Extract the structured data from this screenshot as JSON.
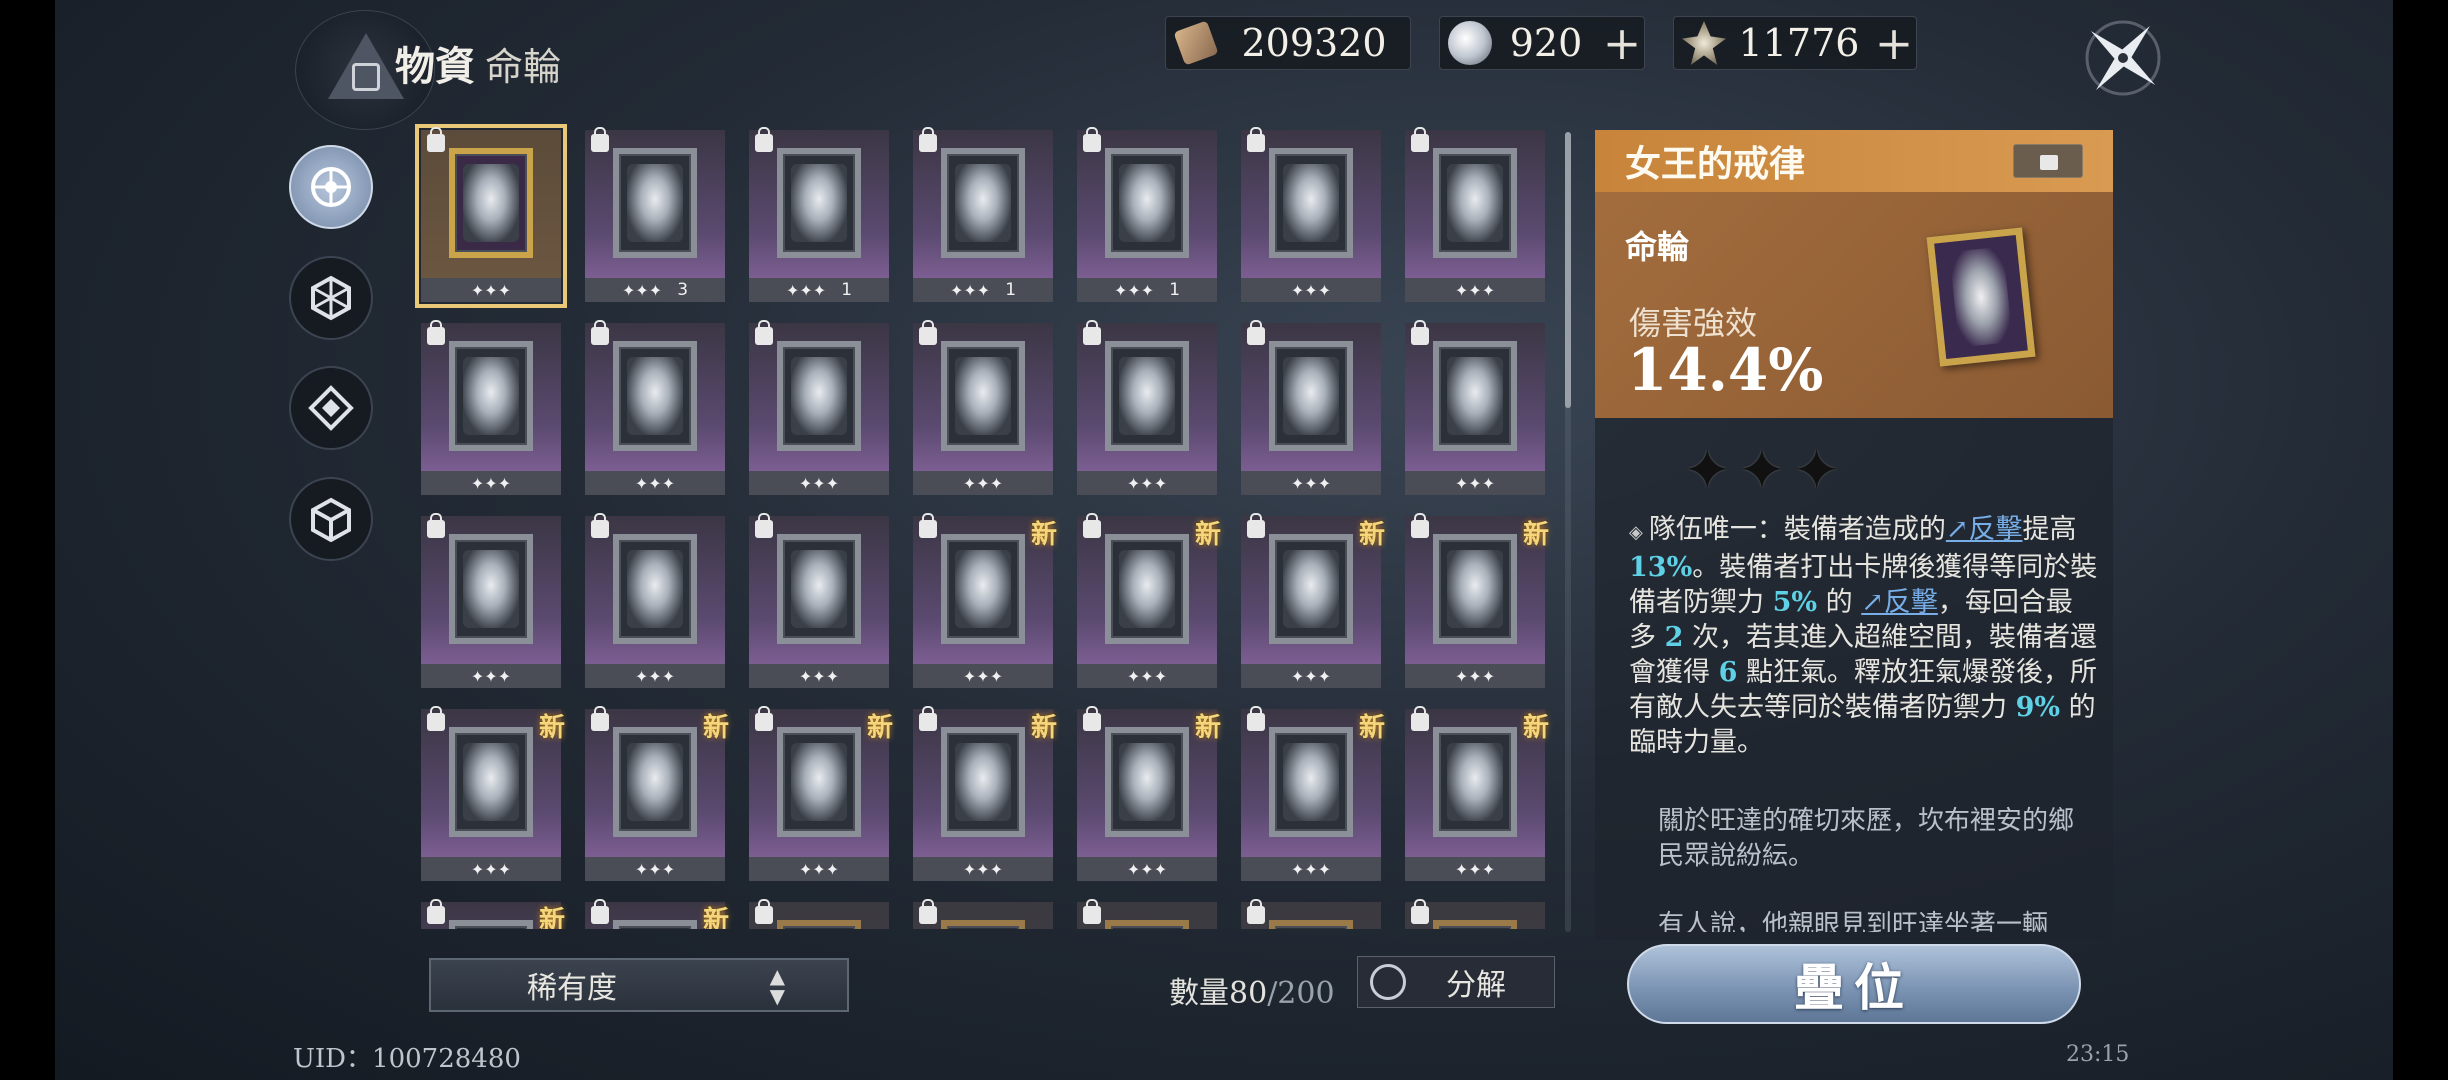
{
  "header": {
    "title": "物資",
    "subtitle": "命輪"
  },
  "currencies": [
    {
      "icon": "ticket-icon",
      "value": "209320",
      "has_plus": false
    },
    {
      "icon": "orb-icon",
      "value": "920",
      "has_plus": true
    },
    {
      "icon": "shard-icon",
      "value": "11776",
      "has_plus": true
    }
  ],
  "plus_label": "+",
  "nav": [
    {
      "name": "nav-destiny-wheel",
      "active": true
    },
    {
      "name": "nav-hexagon",
      "active": false
    },
    {
      "name": "nav-diamond",
      "active": false
    },
    {
      "name": "nav-cube",
      "active": false
    }
  ],
  "grid": {
    "new_label": "新",
    "rows": [
      [
        {
          "stars": "✦✦✦",
          "count": "",
          "new": false,
          "selected": true
        },
        {
          "stars": "✦✦✦",
          "count": "3",
          "new": false
        },
        {
          "stars": "✦✦✦",
          "count": "1",
          "new": false
        },
        {
          "stars": "✦✦✦",
          "count": "1",
          "new": false
        },
        {
          "stars": "✦✦✦",
          "count": "1",
          "new": false
        },
        {
          "stars": "✦✦✦",
          "count": "",
          "new": false
        },
        {
          "stars": "✦✦✦",
          "count": "",
          "new": false
        }
      ],
      [
        {
          "stars": "✦✦✦",
          "count": "",
          "new": false
        },
        {
          "stars": "✦✦✦",
          "count": "",
          "new": false
        },
        {
          "stars": "✦✦✦",
          "count": "",
          "new": false
        },
        {
          "stars": "✦✦✦",
          "count": "",
          "new": false
        },
        {
          "stars": "✦✦✦",
          "count": "",
          "new": false
        },
        {
          "stars": "✦✦✦",
          "count": "",
          "new": false
        },
        {
          "stars": "✦✦✦",
          "count": "",
          "new": false
        }
      ],
      [
        {
          "stars": "✦✦✦",
          "count": "",
          "new": false
        },
        {
          "stars": "✦✦✦",
          "count": "",
          "new": false
        },
        {
          "stars": "✦✦✦",
          "count": "",
          "new": false
        },
        {
          "stars": "✦✦✦",
          "count": "",
          "new": true
        },
        {
          "stars": "✦✦✦",
          "count": "",
          "new": true
        },
        {
          "stars": "✦✦✦",
          "count": "",
          "new": true
        },
        {
          "stars": "✦✦✦",
          "count": "",
          "new": true
        }
      ],
      [
        {
          "stars": "✦✦✦",
          "count": "",
          "new": true
        },
        {
          "stars": "✦✦✦",
          "count": "",
          "new": true
        },
        {
          "stars": "✦✦✦",
          "count": "",
          "new": true
        },
        {
          "stars": "✦✦✦",
          "count": "",
          "new": true
        },
        {
          "stars": "✦✦✦",
          "count": "",
          "new": true
        },
        {
          "stars": "✦✦✦",
          "count": "",
          "new": true
        },
        {
          "stars": "✦✦✦",
          "count": "",
          "new": true
        }
      ],
      [
        {
          "stars": "",
          "count": "",
          "new": true
        },
        {
          "stars": "",
          "count": "",
          "new": true
        },
        {
          "stars": "",
          "count": "",
          "new": false,
          "gold": true
        },
        {
          "stars": "",
          "count": "",
          "new": false,
          "gold": true
        },
        {
          "stars": "",
          "count": "",
          "new": false,
          "gold": true
        },
        {
          "stars": "",
          "count": "",
          "new": false,
          "gold": true
        },
        {
          "stars": "",
          "count": "",
          "new": false,
          "gold": true
        }
      ]
    ]
  },
  "detail": {
    "name": "女王的戒律",
    "type": "命輪",
    "stat_label": "傷害強效",
    "stat_value": "14.4%",
    "stars": "✦✦✦",
    "desc": {
      "p1": "隊伍唯一：裝備者造成的",
      "link1": "↗反擊",
      "p2": "提高",
      "v1": "13%",
      "p3": "。裝備者打出卡牌後獲得等同於裝備者防禦力",
      "v2": "5%",
      "p4": "的",
      "link2": "↗反擊",
      "p5": "，每回合最多",
      "v3": "2",
      "p6": "次，若其進入超維空間，裝備者還會獲得",
      "v4": "6",
      "p7": "點狂氣。釋放狂氣爆發後，所有敵人失去等同於裝備者防禦力",
      "v5": "9%",
      "p8": "的臨時力量。"
    },
    "lore": "關於旺達的確切來歷，坎布裡安的鄉民眾說紛紜。",
    "lore2": "有人說，他親眼見到旺達坐著一輛"
  },
  "bottom": {
    "sort_label": "稀有度",
    "capacity_label": "數量",
    "capacity_current": "80",
    "capacity_max": "/200",
    "decompose_label": "分解",
    "stack_label": "疊位"
  },
  "uid": "UID：100728480",
  "clock": "23:15",
  "colors": {
    "accent": "#d99a52",
    "highlight": "#5fd1e6",
    "link": "#77aee8",
    "new": "#f4d67d"
  }
}
